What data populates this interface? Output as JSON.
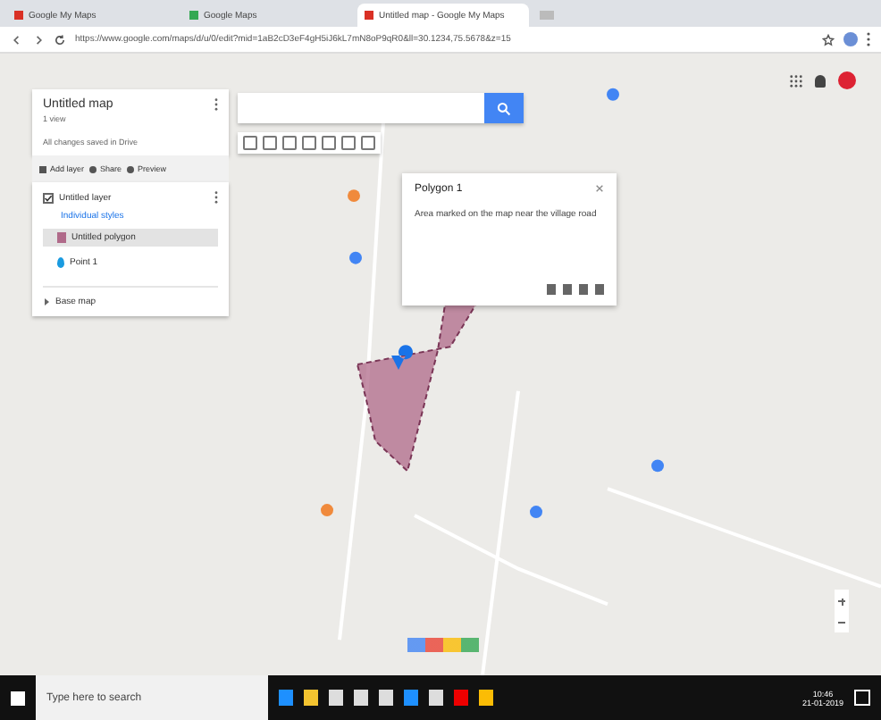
{
  "browser": {
    "tabs": [
      {
        "label": "Google My Maps",
        "selected": false
      },
      {
        "label": "Google Maps",
        "selected": false
      },
      {
        "label": "Untitled map - Google My Maps",
        "selected": true
      }
    ],
    "address": "https://www.google.com/maps/d/u/0/edit?mid=1aB2cD3eF4gH5iJ6kL7mN8oP9qR0&ll=30.1234,75.5678&z=15"
  },
  "map_panel": {
    "title": "Untitled map",
    "subtitle": "1 view",
    "status": "All changes saved in Drive",
    "actions": [
      "Add layer",
      "Share",
      "Preview"
    ],
    "layer": {
      "name": "Untitled layer",
      "checked": true,
      "style": "Individual styles",
      "features": [
        {
          "label": "Untitled polygon",
          "kind": "polygon",
          "selected": true
        },
        {
          "label": "Point 1",
          "kind": "point",
          "selected": false
        }
      ]
    },
    "base_map": {
      "label": "Base map",
      "expanded": false
    }
  },
  "popup": {
    "title": "Polygon 1",
    "description": "Area marked on the map near the village road"
  },
  "taskbar": {
    "search_placeholder": "Type here to search",
    "time": "10:46",
    "date": "21-01-2019"
  }
}
